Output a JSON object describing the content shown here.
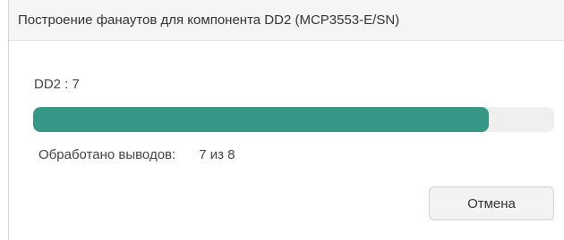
{
  "window": {
    "title": "Построение фанаутов для компонента DD2 (MCP3553-E/SN)"
  },
  "progress": {
    "label": "DD2 : 7",
    "processed": 7,
    "total": 8,
    "fraction": 0.875,
    "status_label": "Обработано выводов:",
    "status_value": "7 из 8",
    "fill_color": "#379786",
    "track_color": "#efefef"
  },
  "buttons": {
    "cancel_label": "Отмена"
  }
}
